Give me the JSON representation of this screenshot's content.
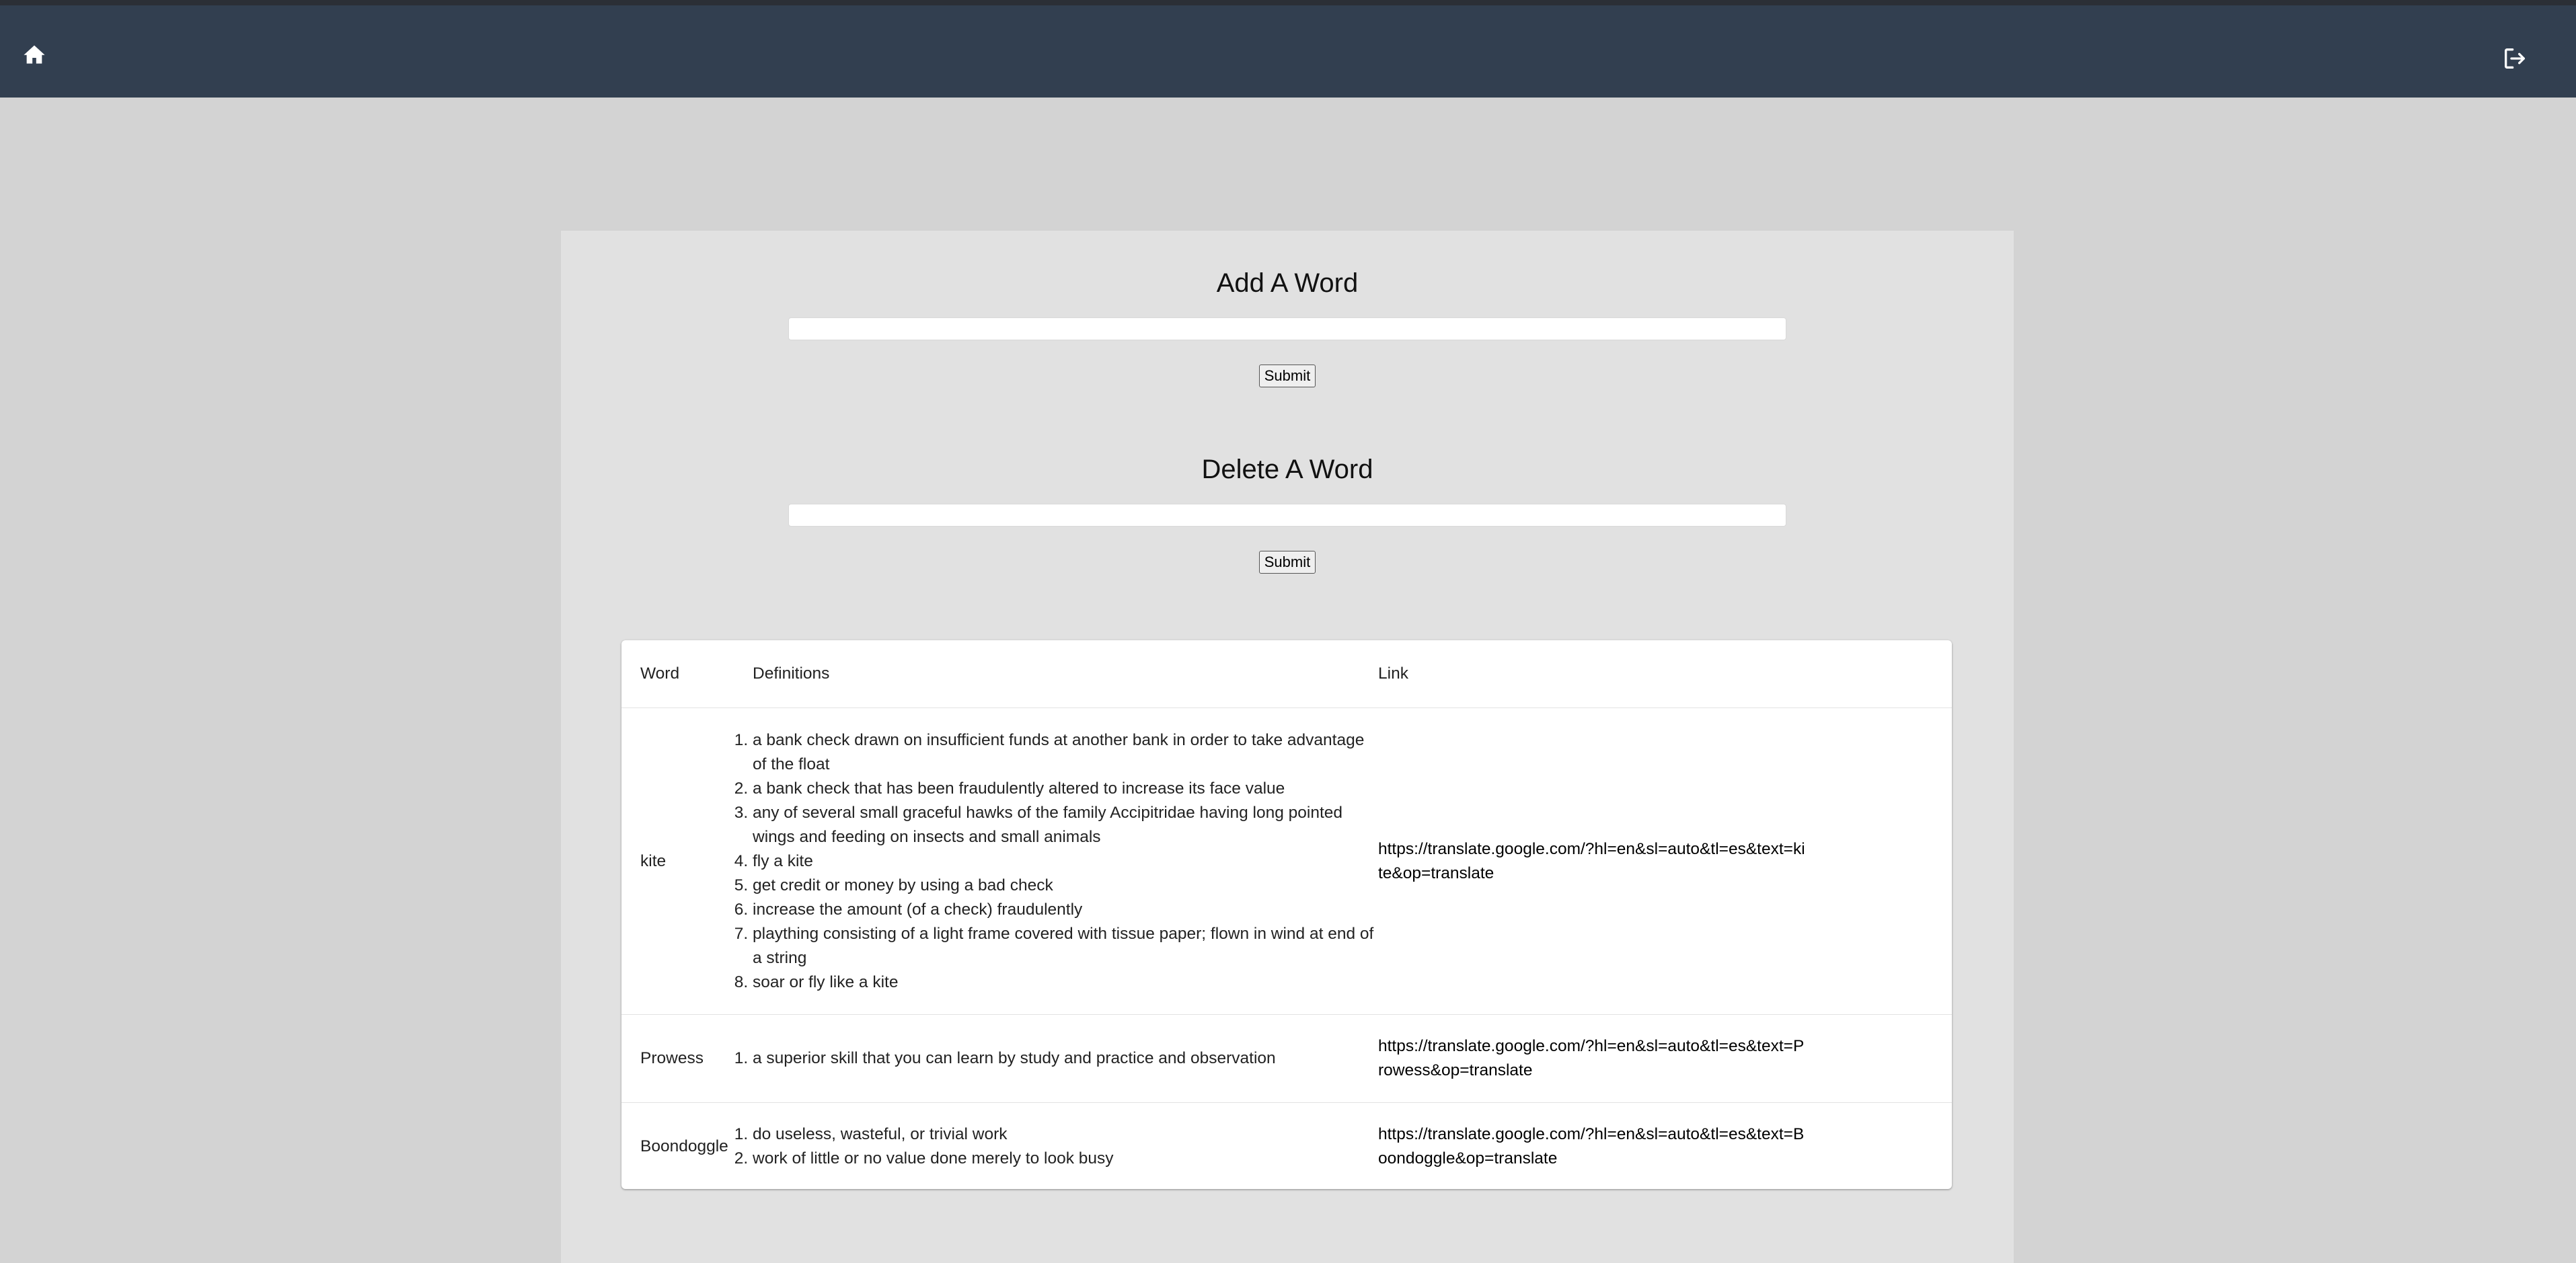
{
  "header": {
    "home_icon": "home-icon",
    "logout_icon": "logout-icon"
  },
  "add_form": {
    "title": "Add A Word",
    "input_value": "",
    "submit_label": "Submit"
  },
  "delete_form": {
    "title": "Delete A Word",
    "input_value": "",
    "submit_label": "Submit"
  },
  "table": {
    "columns": [
      "Word",
      "Definitions",
      "Link"
    ],
    "rows": [
      {
        "word": "kite",
        "definitions": [
          "a bank check drawn on insufficient funds at another bank in order to take advantage of the float",
          "a bank check that has been fraudulently altered to increase its face value",
          "any of several small graceful hawks of the family Accipitridae having long pointed wings and feeding on insects and small animals",
          "fly a kite",
          "get credit or money by using a bad check",
          "increase the amount (of a check) fraudulently",
          "plaything consisting of a light frame covered with tissue paper; flown in wind at end of a string",
          "soar or fly like a kite"
        ],
        "link": "https://translate.google.com/?hl=en&sl=auto&tl=es&text=kite&op=translate"
      },
      {
        "word": "Prowess",
        "definitions": [
          "a superior skill that you can learn by study and practice and observation"
        ],
        "link": "https://translate.google.com/?hl=en&sl=auto&tl=es&text=Prowess&op=translate"
      },
      {
        "word": "Boondoggle",
        "definitions": [
          "do useless, wasteful, or trivial work",
          "work of little or no value done merely to look busy"
        ],
        "link": "https://translate.google.com/?hl=en&sl=auto&tl=es&text=Boondoggle&op=translate"
      }
    ]
  },
  "colors": {
    "appbar": "#323f50",
    "page_background": "#d3d3d3",
    "panel_background": "#e1e1e1",
    "card_background": "#ffffff"
  }
}
